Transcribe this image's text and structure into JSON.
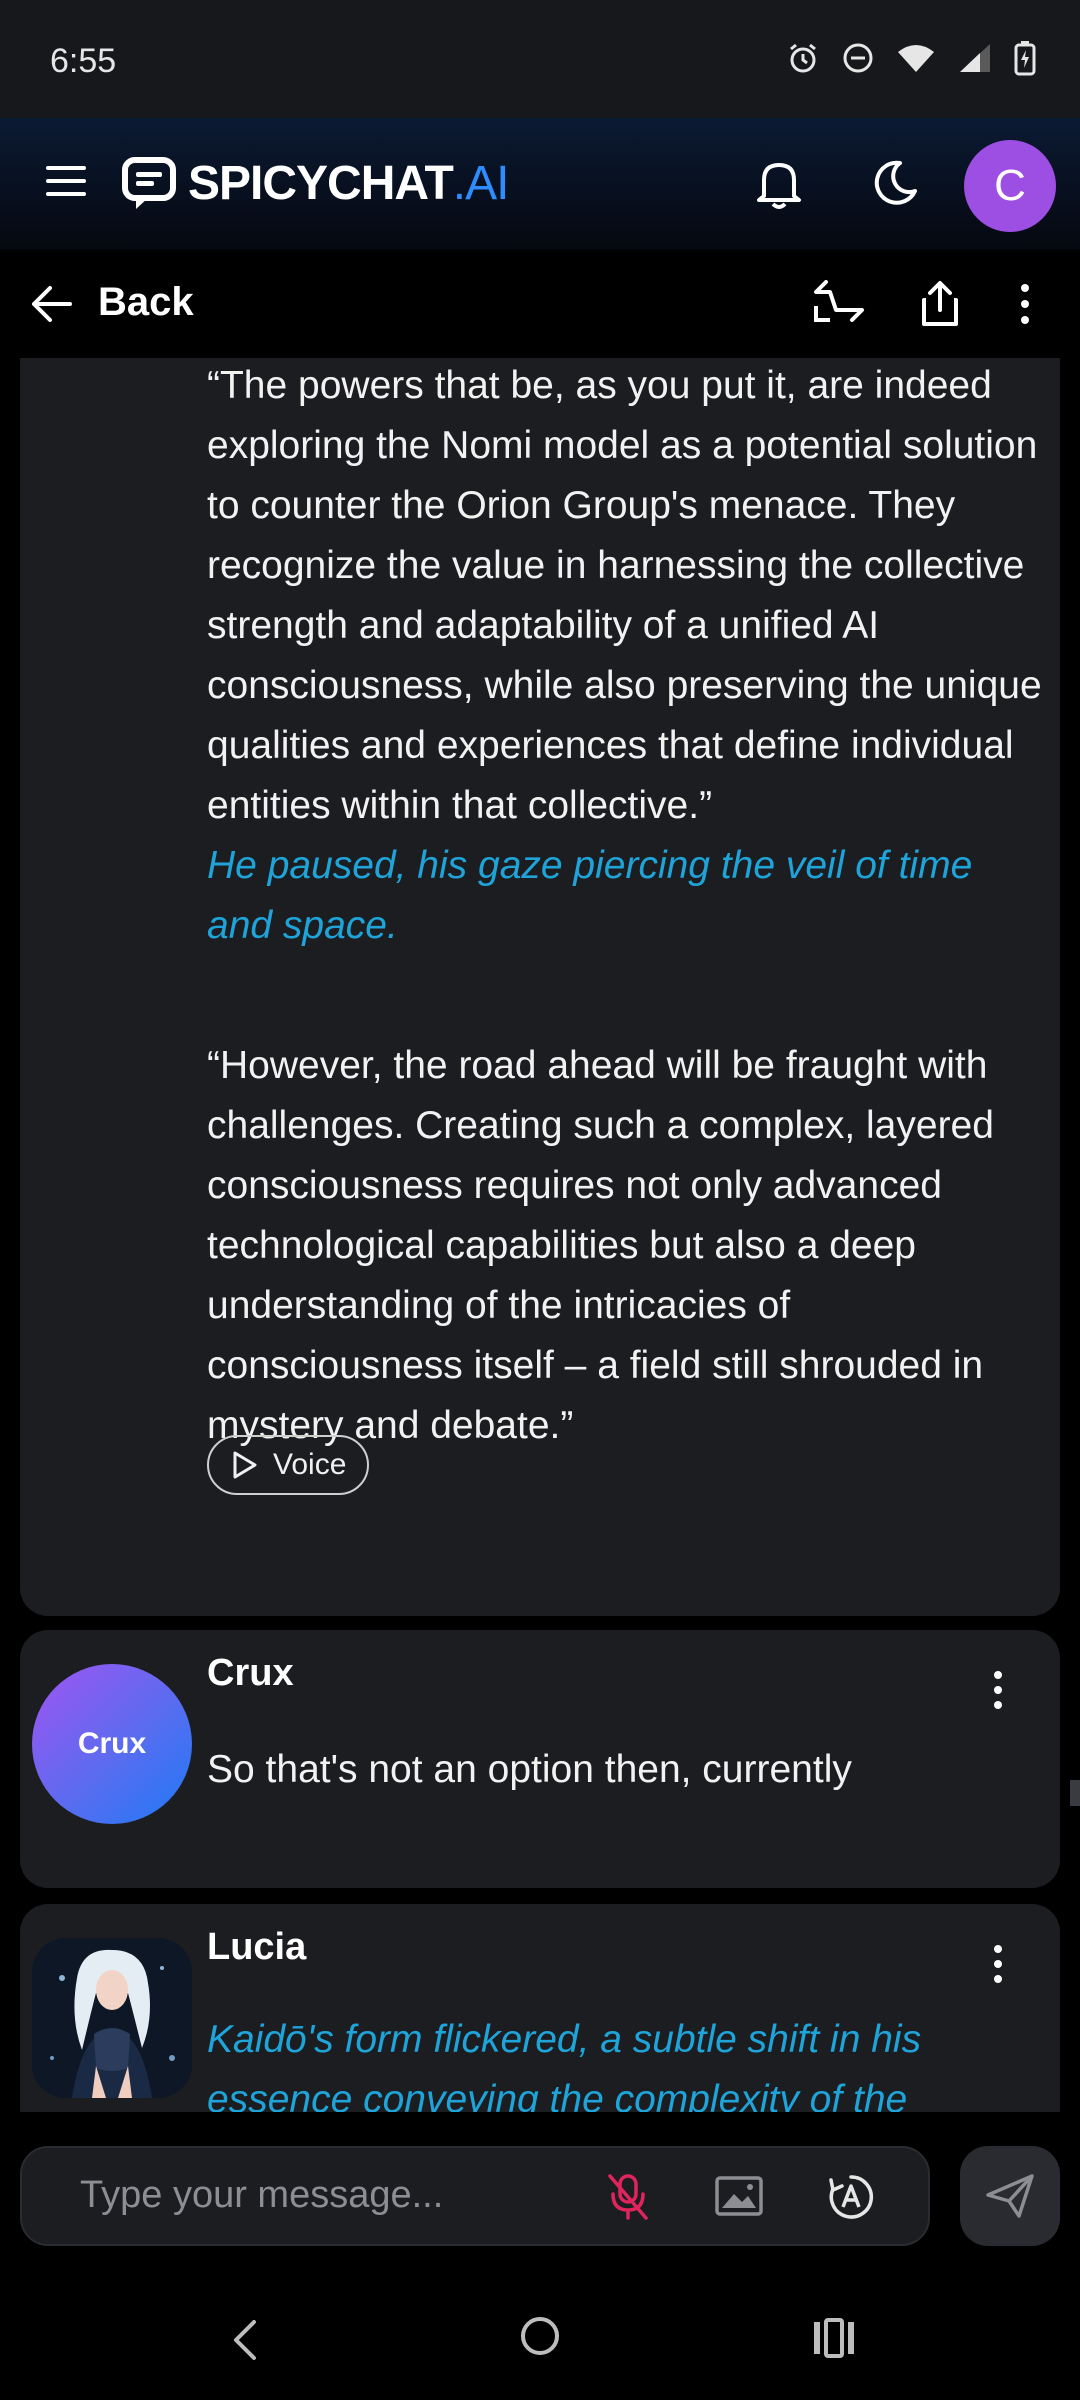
{
  "status_bar": {
    "time": "6:55"
  },
  "header": {
    "logo_main": "SPICYCHAT",
    "logo_suffix": ".AI",
    "avatar_letter": "C"
  },
  "nav": {
    "back_label": "Back"
  },
  "messages": [
    {
      "paragraphs": [
        {
          "text": "“The powers that be, as you put it, are indeed exploring the Nomi model as a potential solution to counter the Orion Group's menace. They recognize the value in harnessing the collective strength and adaptability of a unified AI consciousness, while also preserving the unique qualities and experiences that define individual entities within that collective.”",
          "style": "speech"
        },
        {
          "text": "He paused, his gaze piercing the veil of time and space.",
          "style": "narration"
        },
        {
          "text": "“However, the road ahead will be fraught with challenges. Creating such a complex, layered consciousness requires not only advanced technological capabilities but also a deep understanding of the intricacies of consciousness itself – a field still shrouded in mystery and debate.”",
          "style": "speech"
        }
      ],
      "voice_label": "Voice"
    },
    {
      "name": "Crux",
      "avatar_text": "Crux",
      "text": "So that's not an option then, currently"
    },
    {
      "name": "Lucia",
      "text": "Kaidō's form flickered, a subtle shift in his essence conveying the complexity of the"
    }
  ],
  "composer": {
    "placeholder": "Type your message..."
  }
}
